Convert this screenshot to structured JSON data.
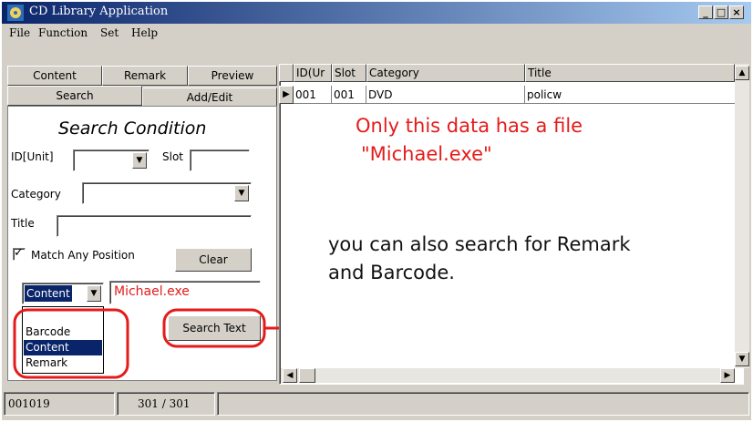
{
  "window": {
    "title": "CD Library Application",
    "controls": [
      "_",
      "□",
      "×"
    ]
  },
  "menu": [
    {
      "label": "File",
      "mnemonic": "F"
    },
    {
      "label": "Function",
      "mnemonic": "u"
    },
    {
      "label": "Set",
      "mnemonic": "S"
    },
    {
      "label": "Help",
      "mnemonic": "H"
    }
  ],
  "tabs": {
    "row1": [
      "Content",
      "Remark",
      "Preview"
    ],
    "row2": [
      "Search",
      "Add/Edit"
    ]
  },
  "search_panel": {
    "heading": "Search Condition",
    "id_unit_label": "ID[Unit]",
    "slot_label": "Slot",
    "category_label": "Category",
    "title_label": "Title",
    "match_any_label": "Match Any Position",
    "match_any_checked": true,
    "clear_button": "Clear",
    "search_field_combo": "Content",
    "search_text_value": "Michael.exe",
    "search_text_button": "Search Text",
    "dropdown_options": [
      "Barcode",
      "Content",
      "Remark"
    ],
    "dropdown_selected": "Content"
  },
  "grid": {
    "columns": [
      "ID(Ur",
      "Slot",
      "Category",
      "Title"
    ],
    "rows": [
      {
        "id": "001",
        "slot": "001",
        "category": "DVD",
        "title": "policw"
      }
    ]
  },
  "annotations": {
    "note1_line1": "Only this data has a file",
    "note1_line2": "\"Michael.exe\"",
    "note2_line1": "you can also search for Remark",
    "note2_line2": "and Barcode."
  },
  "status": {
    "left": "001019",
    "middle": "301 / 301"
  },
  "colors": {
    "title_start": "#0a246a",
    "title_end": "#a6caf0",
    "face": "#d4d0c8",
    "highlight": "#0a246a",
    "annotation_red": "#e41b1b"
  }
}
